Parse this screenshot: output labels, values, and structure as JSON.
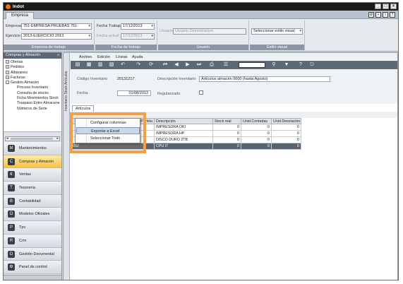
{
  "app": {
    "title": "Indot"
  },
  "ribbon_tabs": [
    "Empresa"
  ],
  "ribbon": {
    "empresa_label": "Empresa",
    "empresa_value": "751-EMPRESA PRUEBAS 751-",
    "ejercicio_label": "Ejercicio",
    "ejercicio_value": "2013-EJERCICIO 2013",
    "group1_label": "Empresa de trabajo",
    "fecha_trabajo_label": "Fecha Trabajo",
    "fecha_trabajo_value": "17/12/2013",
    "fecha_actual_label": "Fecha actual",
    "fecha_actual_value": "17/12/2013",
    "group2_label": "Fecha de trabajo",
    "usuario_label": "Usuario",
    "usuario_value": "Usuario Demostracion",
    "group3_label": "Usuario",
    "estilo_value": "Seleccionar estilo visual",
    "group4_label": "Estilo visual"
  },
  "nav": {
    "header": "Compras y Almacén",
    "tree": [
      {
        "label": "Ofertas",
        "expander": "+"
      },
      {
        "label": "Pedidos",
        "expander": "+"
      },
      {
        "label": "Albaranes",
        "expander": "+"
      },
      {
        "label": "Facturas",
        "expander": "+"
      },
      {
        "label": "Gestión Almacén",
        "expander": "-"
      }
    ],
    "subitems": [
      "Proceso Inventario",
      "Consulta de stocks",
      "Ficha Movimientos Stock",
      "Traspaso Entre Almacene",
      "Números de Serie"
    ],
    "modules": [
      {
        "label": "Mantenimientos",
        "icon": "M",
        "active": false
      },
      {
        "label": "Compras y Almacén",
        "icon": "C",
        "active": true
      },
      {
        "label": "Ventas",
        "icon": "€",
        "active": false
      },
      {
        "label": "Tesorería",
        "icon": "T",
        "active": false
      },
      {
        "label": "Contabilidad",
        "icon": "B",
        "active": false
      },
      {
        "label": "Modelos Oficiales",
        "icon": "O",
        "active": false
      },
      {
        "label": "Tpv",
        "icon": "P",
        "active": false
      },
      {
        "label": "Crm",
        "icon": "R",
        "active": false
      },
      {
        "label": "Gestión Documental",
        "icon": "D",
        "active": false
      },
      {
        "label": "Panel de control",
        "icon": "⚙",
        "active": false
      }
    ]
  },
  "form": {
    "vertical_tab": "Inventario Stock Artículos",
    "menu": [
      "Archivo",
      "Edición",
      "Líneas",
      "Ayuda"
    ],
    "codigo_label": "Código Inventario",
    "codigo_value": "20131217",
    "descripcion_label": "Descripción Inventario",
    "descripcion_value": "Artículos almacén 0000 (hasta Agosto)",
    "fecha_label": "Fecha",
    "fecha_value": "01/08/2013",
    "regularizado_label": "Regularizado",
    "subtab": "Artículos",
    "actions": {
      "nuevo": "Nuevo",
      "editar": "Editar",
      "eliminar": "Eliminar"
    }
  },
  "grid": {
    "columns": [
      "Partida",
      "Descripción",
      "Stock real",
      "Unid.Contadas",
      "Unid.Desviación"
    ],
    "rows": [
      {
        "partida": "",
        "descripcion": "IMPRESORA OKI",
        "stock": "0",
        "contadas": "0",
        "desviacion": "0"
      },
      {
        "partida": "",
        "descripcion": "IMPRESORA HP",
        "stock": "0",
        "contadas": "0",
        "desviacion": "0"
      },
      {
        "partida": "",
        "descripcion": "DISCO DURO 2TB",
        "stock": "0",
        "contadas": "0",
        "desviacion": "0"
      },
      {
        "partida": "",
        "descripcion": "CPU I7",
        "stock": "0",
        "contadas": "0",
        "desviacion": "0"
      }
    ],
    "selected_row_code": "002"
  },
  "context_menu": {
    "items": [
      "Configurar columnas",
      "Exportar a Excel",
      "Seleccionar Todo"
    ],
    "hovered_index": 1,
    "highlight_color": "#f1a04a"
  }
}
